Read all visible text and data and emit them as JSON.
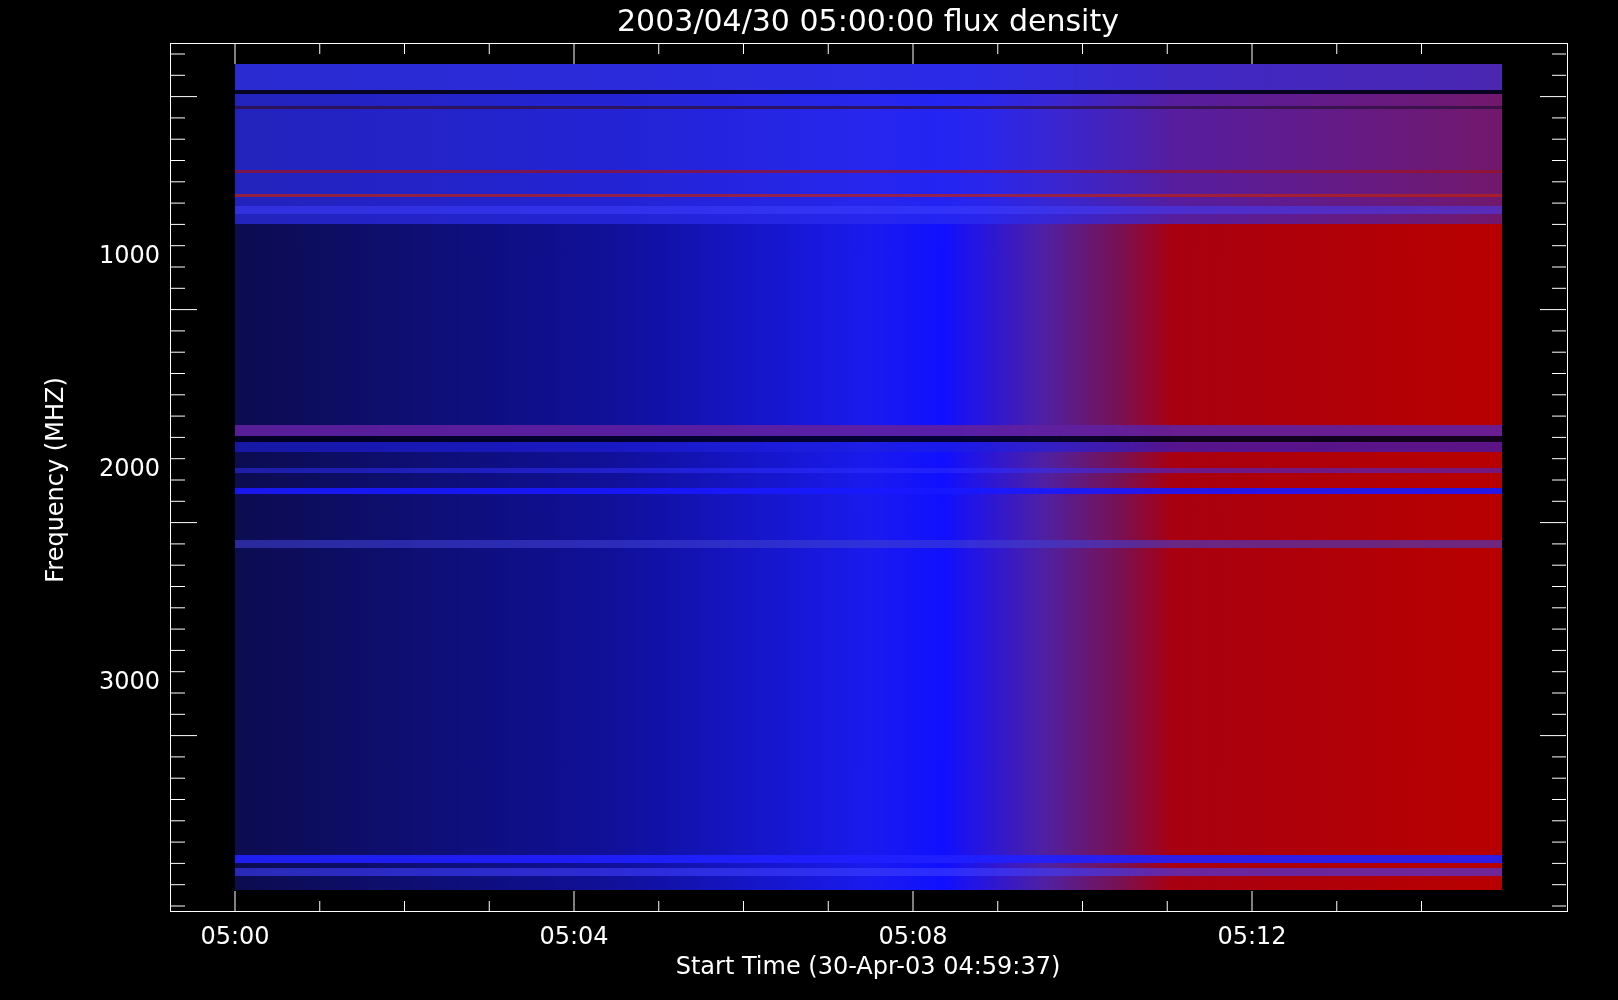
{
  "title": "2003/04/30 05:00:00 flux density",
  "x_axis": {
    "label": "Start Time (30-Apr-03 04:59:37)",
    "ticks": [
      "05:00",
      "05:04",
      "05:08",
      "05:12"
    ]
  },
  "y_axis": {
    "label": "Frequency (MHZ)",
    "ticks": [
      "1000",
      "2000",
      "3000"
    ]
  }
}
